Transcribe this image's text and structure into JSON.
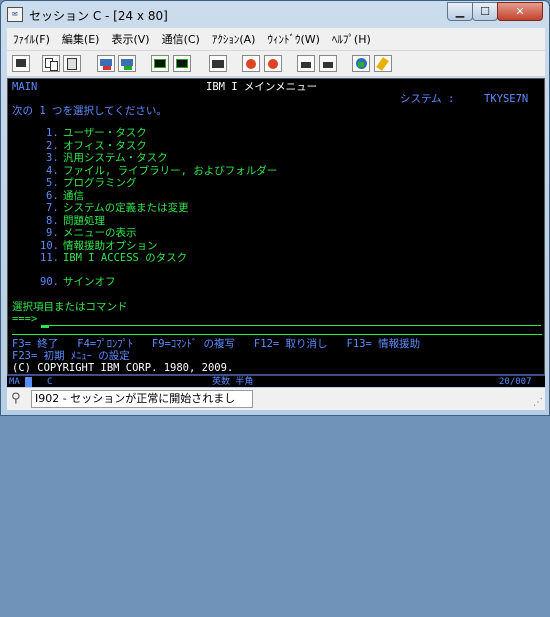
{
  "window": {
    "title": "セッション C - [24 x 80]",
    "app_icon_text": "✉"
  },
  "menu": [
    "ﾌｧｲﾙ(F)",
    "編集(E)",
    "表示(V)",
    "通信(C)",
    "ｱｸｼｮﾝ(A)",
    "ｳｨﾝﾄﾞｳ(W)",
    "ﾍﾙﾌﾟ(H)"
  ],
  "toolbar_icons": [
    "print-screen-icon",
    "copy-icon",
    "paste-icon",
    "send-file-icon",
    "receive-file-icon",
    "display-icon",
    "keyboard-icon",
    "macro-record-icon",
    "macro-play-icon",
    "macro-stop-icon",
    "macro-pause-icon",
    "macro-edit-icon",
    "globe-icon",
    "highlighter-icon"
  ],
  "terminal": {
    "screen_id": "MAIN",
    "screen_title": "IBM I メインメニュー",
    "system_label": "システム :",
    "system_name": "TKYSE7N",
    "prompt": "次の 1 つを選択してください。",
    "options": [
      {
        "num": "1.",
        "label": "ユーザー・タスク"
      },
      {
        "num": "2.",
        "label": "オフィス・タスク"
      },
      {
        "num": "3.",
        "label": "汎用システム・タスク"
      },
      {
        "num": "4.",
        "label": "ファイル, ライブラリー, およびフォルダー"
      },
      {
        "num": "5.",
        "label": "プログラミング"
      },
      {
        "num": "6.",
        "label": "通信"
      },
      {
        "num": "7.",
        "label": "システムの定義または変更"
      },
      {
        "num": "8.",
        "label": "問題処理"
      },
      {
        "num": "9.",
        "label": "メニューの表示"
      },
      {
        "num": "10.",
        "label": "情報援助オプション"
      },
      {
        "num": "11.",
        "label": "IBM I ACCESS のタスク"
      }
    ],
    "signoff": {
      "num": "90.",
      "label": "サインオフ"
    },
    "command_label": "選択項目またはコマンド",
    "command_arrow": "===>",
    "fkeys_line1": "F3= 終了   F4=ﾌﾟﾛﾝﾌﾟﾄ   F9=ｺﾏﾝﾄﾞ の複写   F12= 取り消し   F13= 情報援助",
    "fkeys_line2": "F23= 初期 ﾒﾆｭｰ の設定",
    "copyright": "(C) COPYRIGHT IBM CORP. 1980, 2009."
  },
  "oia": {
    "ma": "MA",
    "session": "C",
    "mode": "英数 半角",
    "cursor_pos": "20/007"
  },
  "statusbar": {
    "message": "I902 - セッションが正常に開始されまし"
  }
}
